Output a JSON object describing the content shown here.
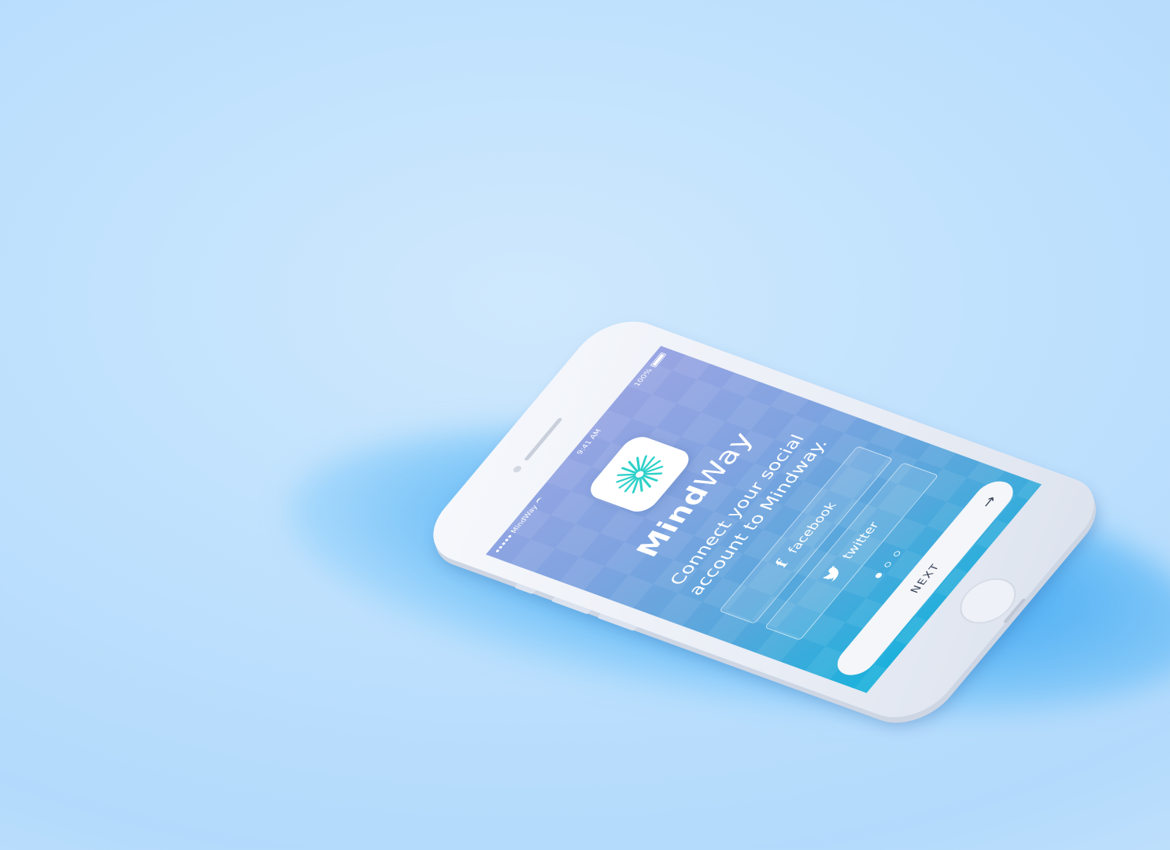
{
  "status_bar": {
    "carrier": "MindWay",
    "time": "9:41 AM",
    "battery": "100%"
  },
  "app": {
    "name_bold": "Mind",
    "name_light": "Way",
    "tagline_line1": "Connect your social",
    "tagline_line2": "account to Mindway."
  },
  "social": {
    "facebook_label": "facebook",
    "twitter_label": "twitter"
  },
  "pager": {
    "total": 3,
    "active": 1
  },
  "next_button": {
    "label": "NEXT",
    "arrow": "→"
  },
  "colors": {
    "icon_accent": "#2ed1c9",
    "screen_top": "#9aa5e3",
    "screen_bottom": "#19b1dc"
  }
}
